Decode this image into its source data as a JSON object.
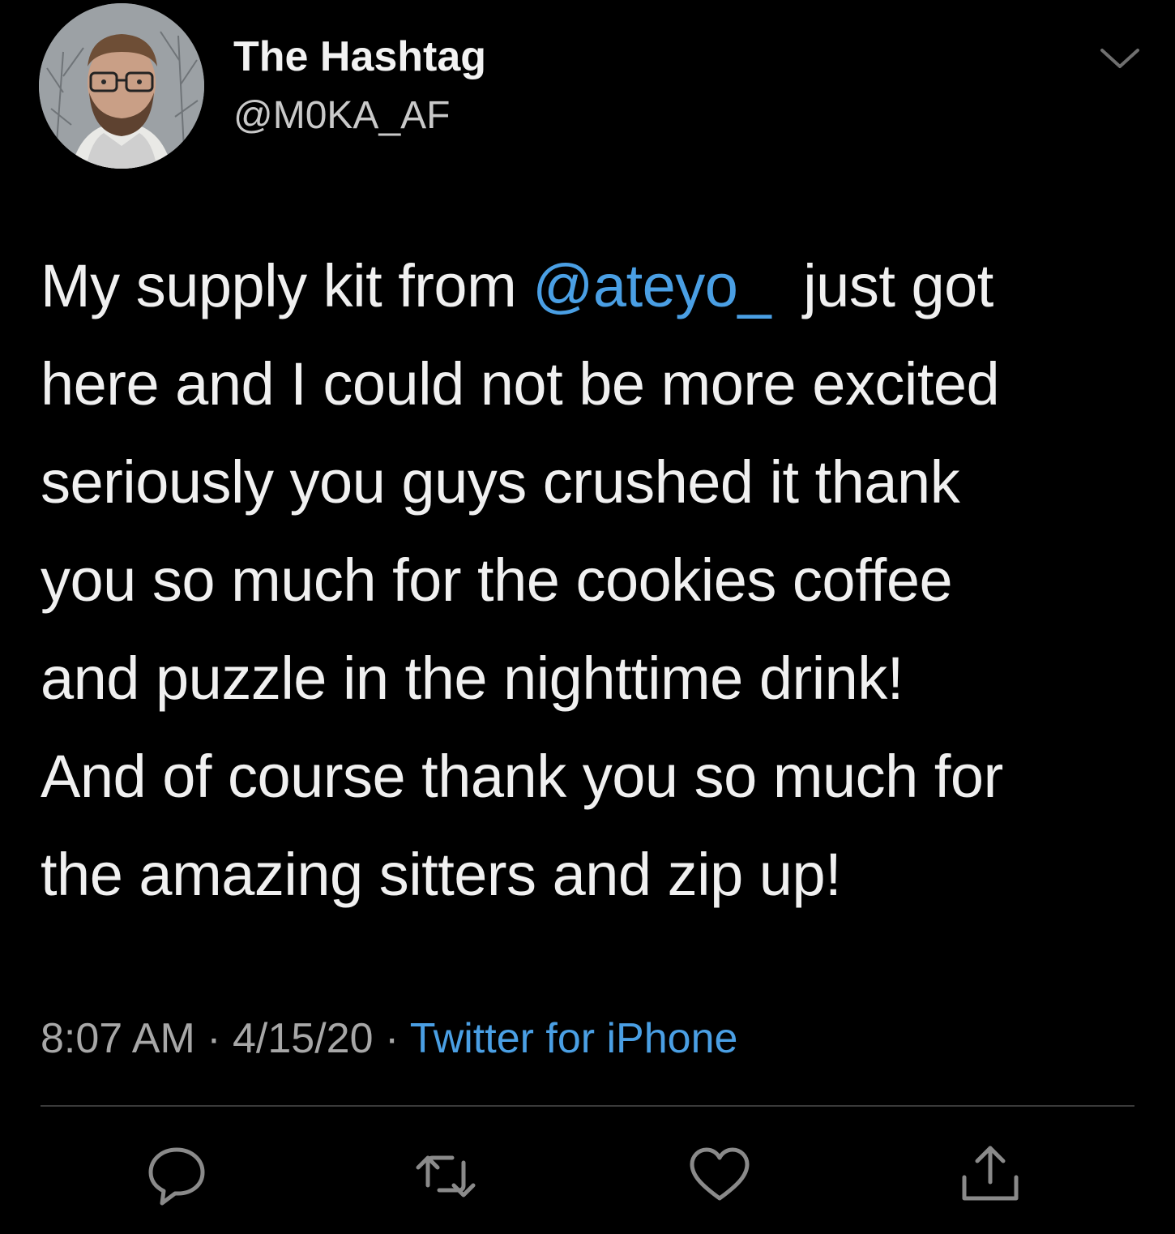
{
  "author": {
    "display_name": "The Hashtag",
    "handle": "@M0KA_AF",
    "avatar_icon": "profile-photo"
  },
  "tweet": {
    "lines": [
      {
        "before": "My supply kit from ",
        "mention": "@ateyo_",
        "after": "  just got"
      },
      {
        "text": "here and I could not be more excited"
      },
      {
        "text": "seriously you guys crushed it thank"
      },
      {
        "text": "you so much for the cookies coffee"
      },
      {
        "text": "and puzzle in the nighttime drink!"
      },
      {
        "text": "And of course thank you so much for"
      },
      {
        "text": "the amazing sitters and zip up!"
      }
    ],
    "time": "8:07 AM",
    "date": "4/15/20",
    "separator": " · ",
    "source": "Twitter for iPhone"
  },
  "actions": {
    "reply_icon": "reply-icon",
    "retweet_icon": "retweet-icon",
    "like_icon": "heart-icon",
    "share_icon": "share-icon"
  },
  "colors": {
    "background": "#000000",
    "text": "#f0f0f0",
    "link": "#4a9fe4",
    "muted": "#a7a7a7",
    "icon": "#8a8a8a"
  }
}
